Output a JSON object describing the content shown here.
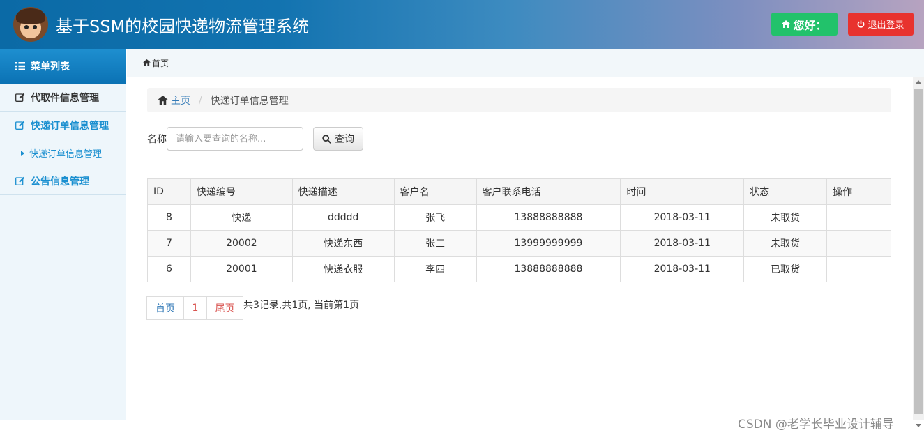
{
  "header": {
    "title": "基于SSM的校园快递物流管理系统",
    "hello_label": "您好：",
    "logout_label": "退出登录"
  },
  "sidebar": {
    "heading": "菜单列表",
    "items": [
      {
        "label": "代取件信息管理"
      },
      {
        "label": "快递订单信息管理"
      },
      {
        "label": "快递订单信息管理"
      },
      {
        "label": "公告信息管理"
      }
    ]
  },
  "tabbar": {
    "home_label": "首页"
  },
  "breadcrumb": {
    "home": "主页",
    "current": "快递订单信息管理"
  },
  "search": {
    "label": "名称",
    "placeholder": "请输入要查询的名称...",
    "button": "查询"
  },
  "table": {
    "headers": [
      "ID",
      "快递编号",
      "快递描述",
      "客户名",
      "客户联系电话",
      "时间",
      "状态",
      "操作"
    ],
    "rows": [
      [
        "8",
        "快递",
        "ddddd",
        "张飞",
        "13888888888",
        "2018-03-11",
        "未取货",
        ""
      ],
      [
        "7",
        "20002",
        "快递东西",
        "张三",
        "13999999999",
        "2018-03-11",
        "未取货",
        ""
      ],
      [
        "6",
        "20001",
        "快递衣服",
        "李四",
        "13888888888",
        "2018-03-11",
        "已取货",
        ""
      ]
    ]
  },
  "pager": {
    "first": "首页",
    "page": "1",
    "last": "尾页",
    "info": "共3记录,共1页, 当前第1页"
  },
  "watermark": "CSDN @老学长毕业设计辅导",
  "colors": {
    "accent": "#1a8fd0",
    "success": "#22c26b",
    "danger": "#e8322e",
    "link": "#337ab7"
  }
}
